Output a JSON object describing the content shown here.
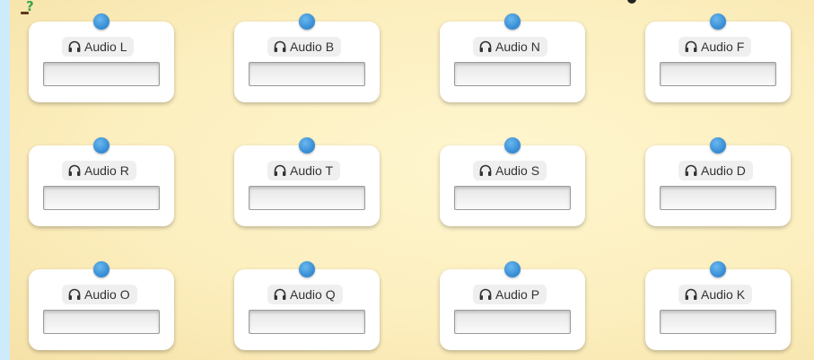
{
  "cards": [
    {
      "label": "Audio L"
    },
    {
      "label": "Audio B"
    },
    {
      "label": "Audio N"
    },
    {
      "label": "Audio F"
    },
    {
      "label": "Audio R"
    },
    {
      "label": "Audio T"
    },
    {
      "label": "Audio S"
    },
    {
      "label": "Audio D"
    },
    {
      "label": "Audio O"
    },
    {
      "label": "Audio Q"
    },
    {
      "label": "Audio P"
    },
    {
      "label": "Audio K"
    }
  ],
  "icons": {
    "help": "help-question-icon",
    "audio": "headphones-icon"
  },
  "colors": {
    "pin": "#3a8fd6",
    "background": "#cdebfa",
    "board": "#fcefbf"
  }
}
